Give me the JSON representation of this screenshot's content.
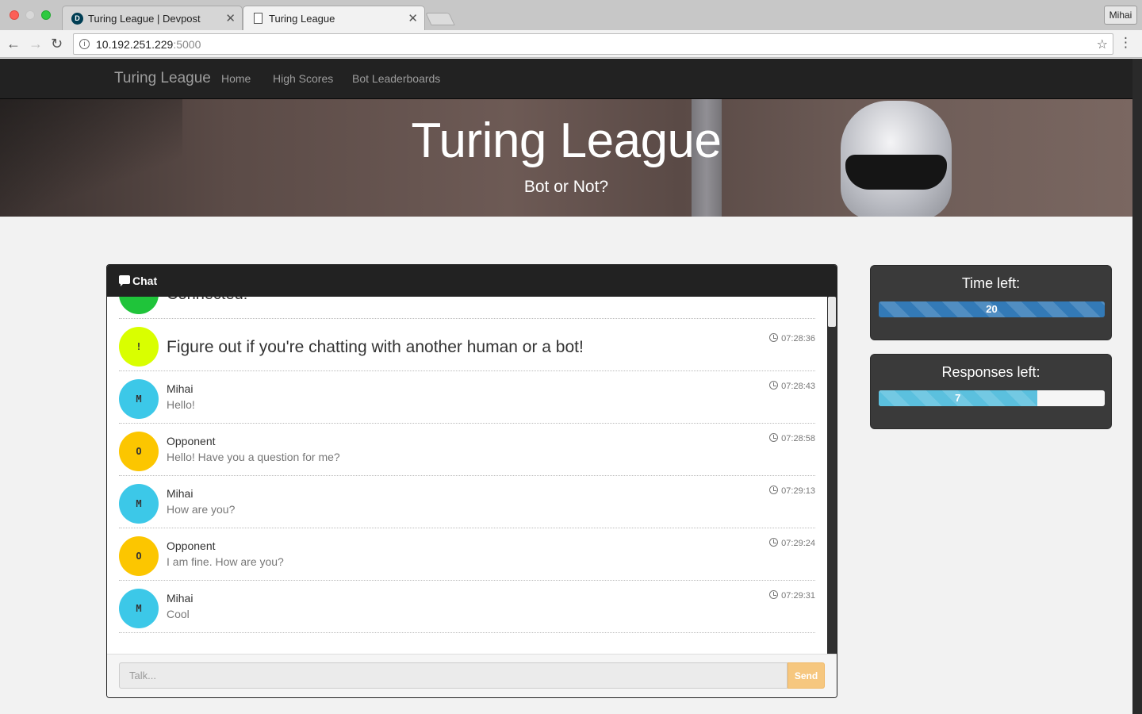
{
  "browser": {
    "tabs": [
      {
        "title": "Turing League | Devpost",
        "icon": "devpost-icon",
        "icon_letter": "D",
        "active": false
      },
      {
        "title": "Turing League",
        "icon": "page-icon",
        "active": true
      }
    ],
    "close_glyph": "✕",
    "profile_name": "Mihai",
    "url_host": "10.192.251.229",
    "url_port": ":5000"
  },
  "nav": {
    "brand": "Turing League",
    "links": [
      "Home",
      "High Scores",
      "Bot Leaderboards"
    ]
  },
  "hero": {
    "title": "Turing League",
    "subtitle": "Bot or Not?"
  },
  "chat": {
    "title": "Chat",
    "partial_message": "Connected!",
    "system_message": {
      "avatar": "!",
      "text": "Figure out if you're chatting with another human or a bot!",
      "time": "07:28:36"
    },
    "messages": [
      {
        "avatar": "M",
        "sender": "Mihai",
        "text": "Hello!",
        "time": "07:28:43",
        "color": "#3cc8e8"
      },
      {
        "avatar": "O",
        "sender": "Opponent",
        "text": "Hello! Have you a question for me?",
        "time": "07:28:58",
        "color": "#fcc600"
      },
      {
        "avatar": "M",
        "sender": "Mihai",
        "text": "How are you?",
        "time": "07:29:13",
        "color": "#3cc8e8"
      },
      {
        "avatar": "O",
        "sender": "Opponent",
        "text": "I am fine. How are you?",
        "time": "07:29:24",
        "color": "#fcc600"
      },
      {
        "avatar": "M",
        "sender": "Mihai",
        "text": "Cool",
        "time": "07:29:31",
        "color": "#3cc8e8"
      }
    ],
    "input_placeholder": "Talk...",
    "send_label": "Send"
  },
  "stats": {
    "time_left": {
      "label": "Time left:",
      "value": "20",
      "fraction": 1.0,
      "color": "#337ab7"
    },
    "responses_left": {
      "label": "Responses left:",
      "value": "7",
      "fraction": 0.7,
      "color": "#5bc0de"
    }
  },
  "colors": {
    "navbar": "#222222",
    "system_avatar": "#d9ff00",
    "connected_avatar": "#1fc43a",
    "send_button": "#f6c77f"
  }
}
